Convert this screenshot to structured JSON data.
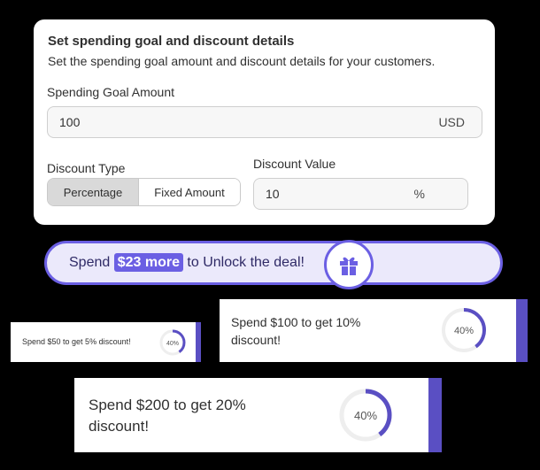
{
  "settings": {
    "title": "Set spending goal and discount details",
    "subtitle": "Set the spending goal amount and discount details for your customers.",
    "goal_label": "Spending Goal Amount",
    "goal_value": "100",
    "goal_currency": "USD",
    "discount_type_label": "Discount Type",
    "discount_type_options": [
      "Percentage",
      "Fixed Amount"
    ],
    "discount_type_selected": "Percentage",
    "discount_value_label": "Discount Value",
    "discount_value": "10",
    "discount_unit": "%"
  },
  "banner": {
    "prefix": "Spend ",
    "highlight": "$23 more",
    "suffix": " to Unlock the deal!",
    "icon": "gift-icon"
  },
  "offers": [
    {
      "text": "Spend $50 to get 5% discount!",
      "progress_label": "40%",
      "progress": 0.4
    },
    {
      "text": "Spend $100 to get 10% discount!",
      "progress_label": "40%",
      "progress": 0.4
    },
    {
      "text": "Spend $200 to get 20% discount!",
      "progress_label": "40%",
      "progress": 0.4
    }
  ],
  "colors": {
    "accent": "#6b5fe3",
    "bar": "#5a4fc3",
    "banner_bg": "#ebe9fb"
  }
}
